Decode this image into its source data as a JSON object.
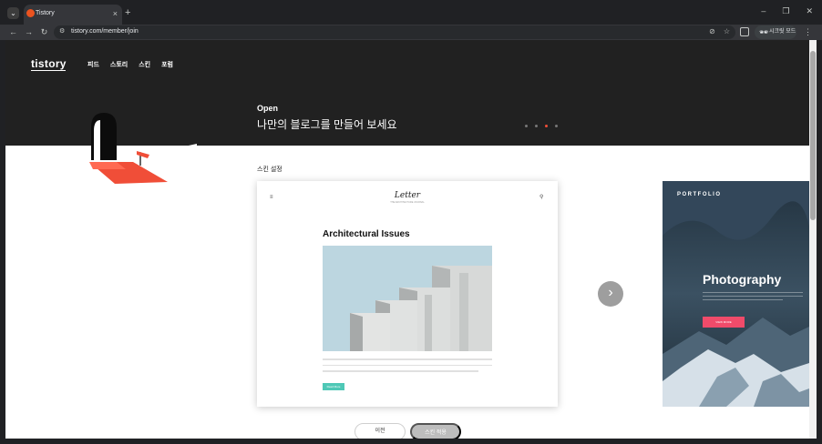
{
  "browser": {
    "tab_title": "Tistory",
    "tab_close_icon": "×",
    "new_tab_icon": "+",
    "url": "tistory.com/member/join",
    "profile_label": "시크릿 모드",
    "win_min": "–",
    "win_restore": "❐",
    "win_close": "✕",
    "back_icon": "←",
    "forward_icon": "→",
    "reload_icon": "↻",
    "tab_menu_icon": "⌄",
    "site_info_icon": "⚙",
    "hide_eye_icon": "⊘",
    "bookmark_icon": "☆",
    "kebab_icon": "⋮",
    "incognito_icon": "🕶"
  },
  "header": {
    "logo": "tistory",
    "nav": [
      "피드",
      "스토리",
      "스킨",
      "포럼"
    ]
  },
  "hero": {
    "open_label": "Open",
    "title": "나만의 블로그를 만들어 보세요",
    "active_dot": 2,
    "dot_count": 4
  },
  "skin": {
    "section_title": "스킨 설정",
    "letter": {
      "menu_icon": "≡",
      "logo": "Letter",
      "logo_sub": "THE ARCHITECTURE JOURNAL",
      "search_icon": "⚲",
      "post_title": "Architectural Issues",
      "read_more": "Read More"
    },
    "portfolio": {
      "label": "PORTFOLIO",
      "title": "Photography",
      "button": "VIEW MORE"
    },
    "next_icon": "›"
  },
  "actions": {
    "prev": "이전",
    "select": "스킨 적용"
  },
  "colors": {
    "accent": "#f04e38",
    "hero_bg": "#212121",
    "mint": "#4fc8b6",
    "pink": "#f04b6a"
  }
}
